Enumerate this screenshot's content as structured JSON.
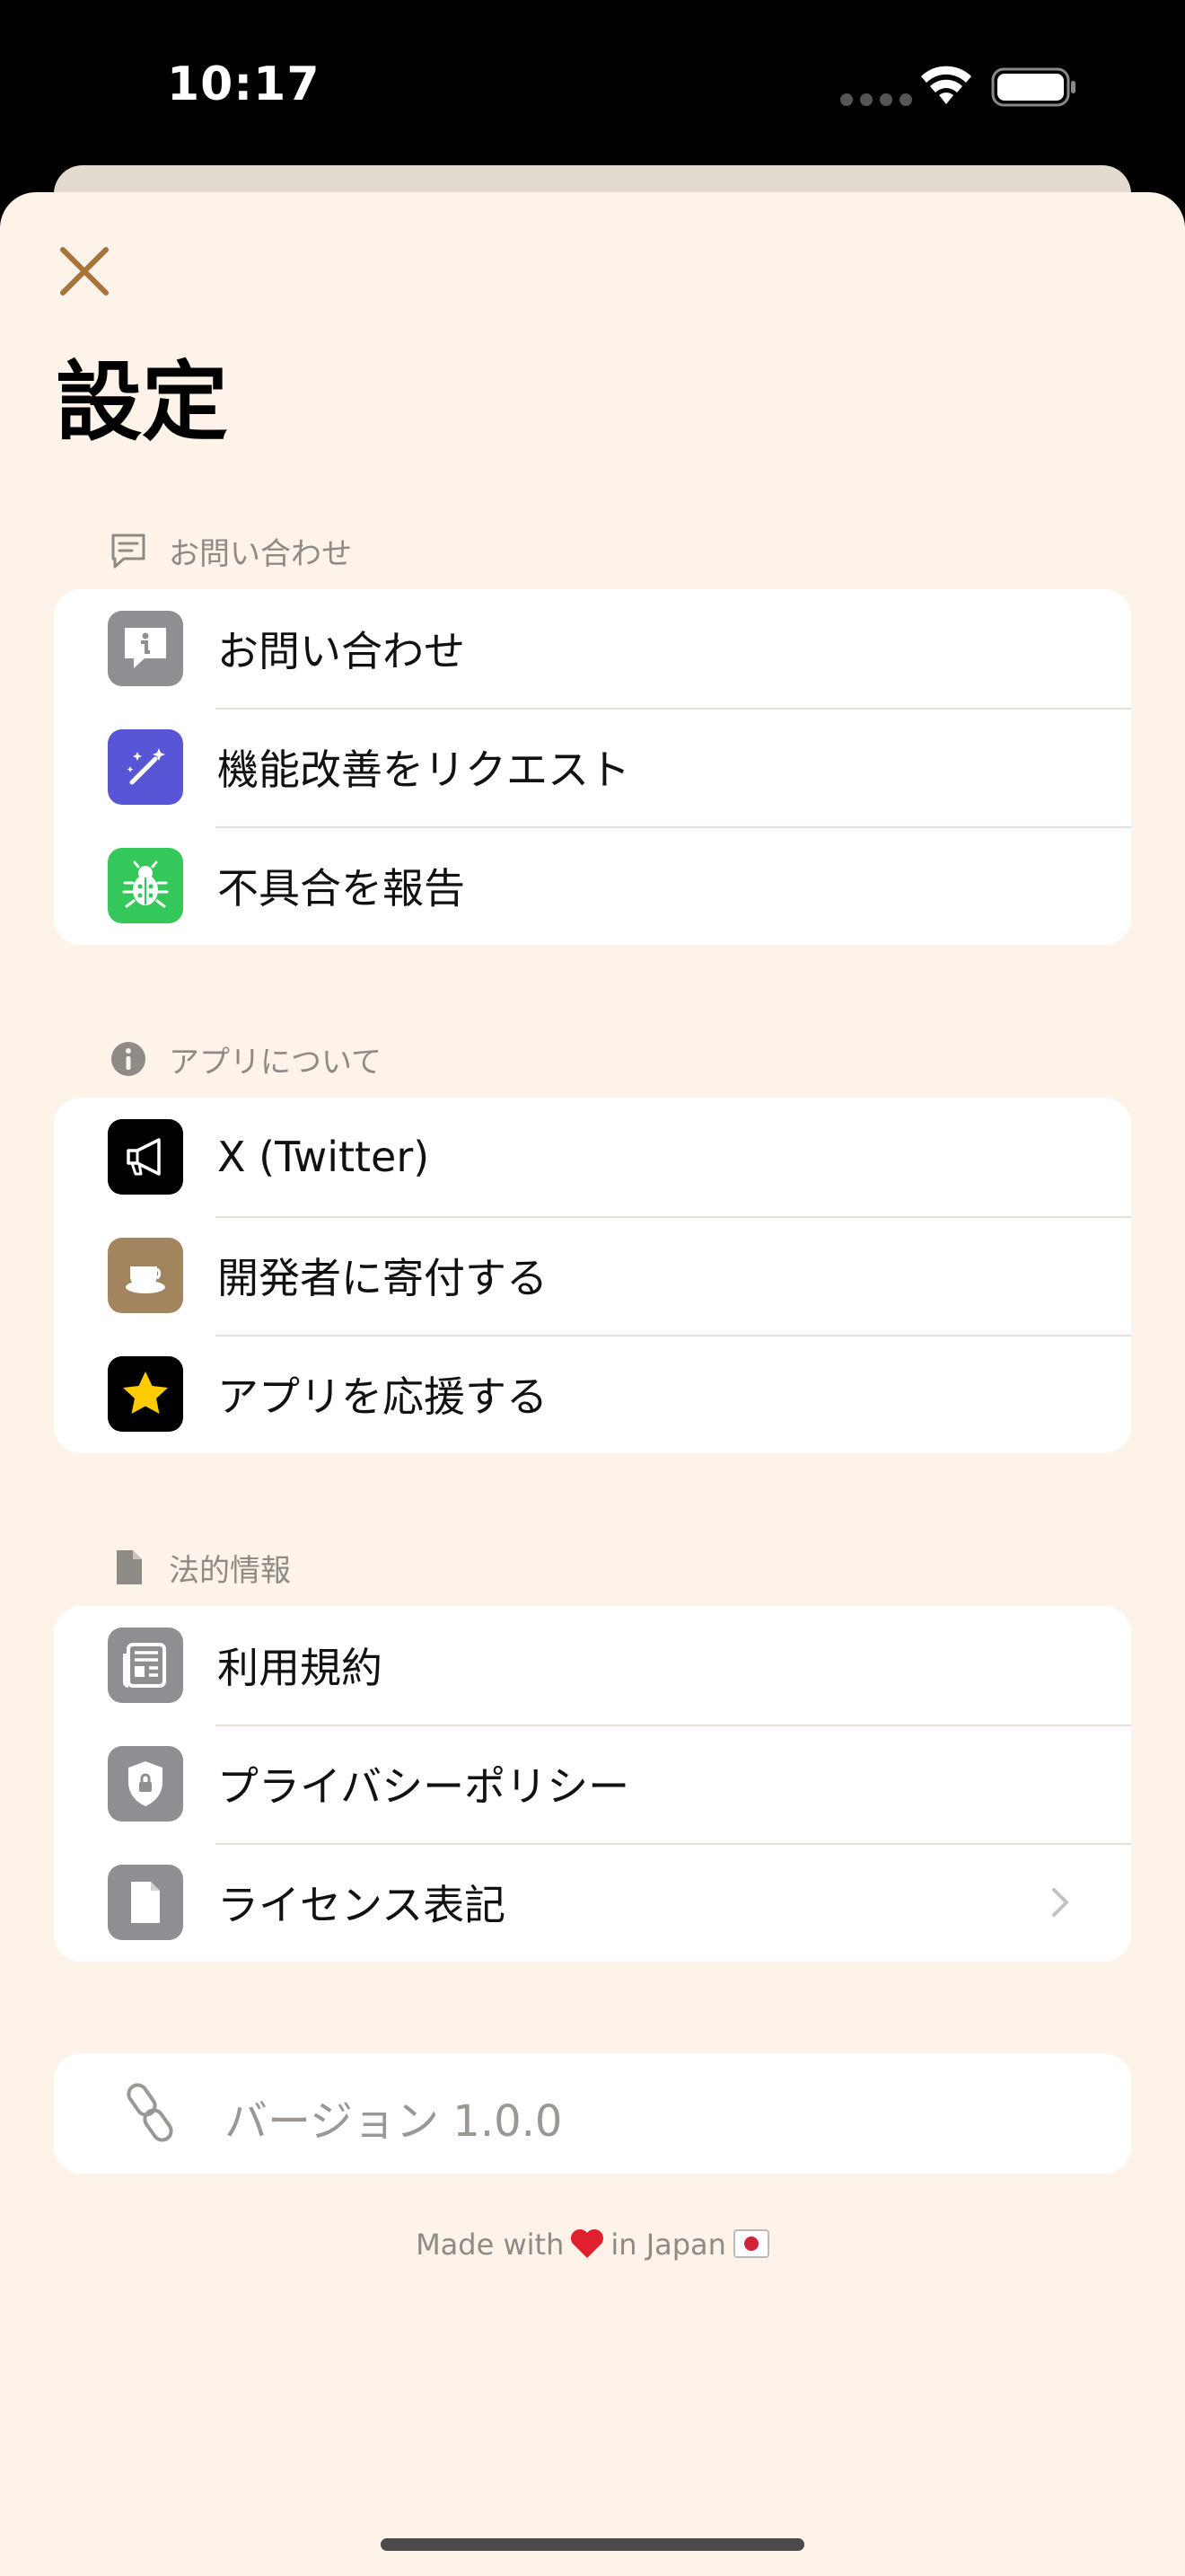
{
  "status_bar": {
    "time": "10:17"
  },
  "page": {
    "title": "設定"
  },
  "sections": [
    {
      "header": "お問い合わせ",
      "header_icon": "message-icon",
      "items": [
        {
          "label": "お問い合わせ",
          "icon": "info-bubble-icon",
          "icon_bg": "#8e8e93"
        },
        {
          "label": "機能改善をリクエスト",
          "icon": "magic-wand-icon",
          "icon_bg": "#5856d6"
        },
        {
          "label": "不具合を報告",
          "icon": "bug-icon",
          "icon_bg": "#34c759"
        }
      ]
    },
    {
      "header": "アプリについて",
      "header_icon": "info-icon",
      "items": [
        {
          "label": "X (Twitter)",
          "icon": "megaphone-icon",
          "icon_bg": "#000000"
        },
        {
          "label": "開発者に寄付する",
          "icon": "coffee-cup-icon",
          "icon_bg": "#a2845e"
        },
        {
          "label": "アプリを応援する",
          "icon": "star-icon",
          "icon_bg": "#000000"
        }
      ]
    },
    {
      "header": "法的情報",
      "header_icon": "document-icon",
      "items": [
        {
          "label": "利用規約",
          "icon": "newspaper-icon",
          "icon_bg": "#8e8e93"
        },
        {
          "label": "プライバシーポリシー",
          "icon": "shield-lock-icon",
          "icon_bg": "#8e8e93"
        },
        {
          "label": "ライセンス表記",
          "icon": "document-icon",
          "icon_bg": "#8e8e93",
          "has_chevron": true
        }
      ]
    }
  ],
  "version": {
    "label": "バージョン 1.0.0",
    "icon": "link-icon"
  },
  "footer": {
    "prefix": "Made with",
    "suffix": "in Japan"
  },
  "colors": {
    "background": "#fef3e9",
    "accent": "#a8733a",
    "card": "#ffffff",
    "muted_text": "#8e8a85"
  }
}
